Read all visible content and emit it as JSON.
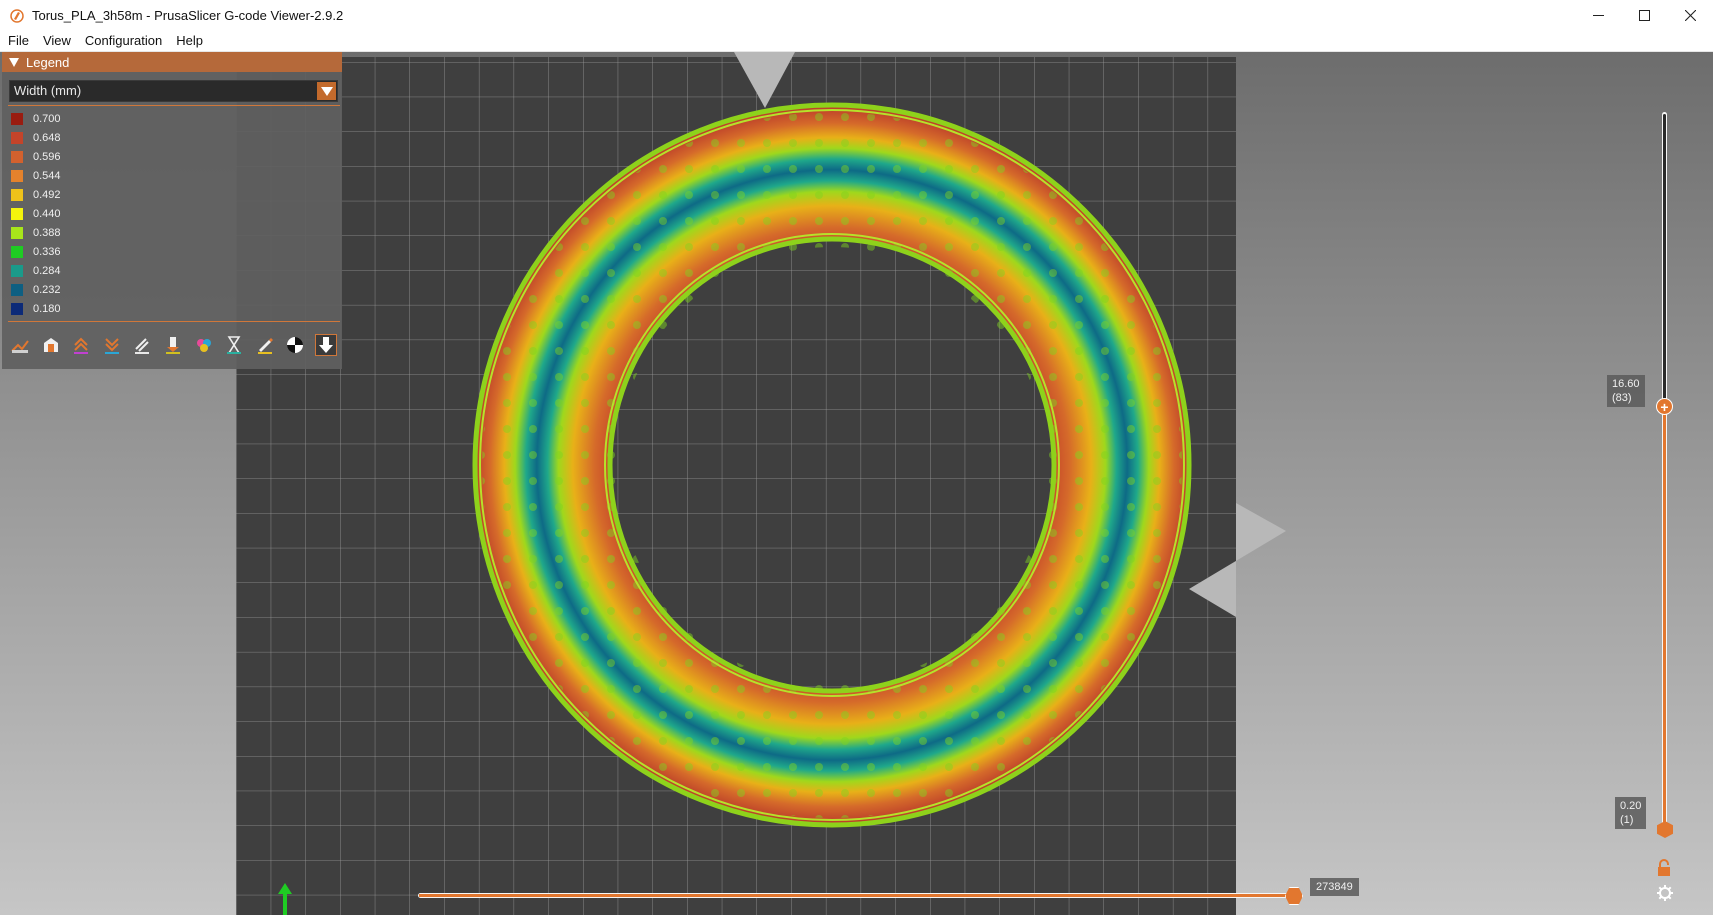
{
  "window": {
    "title": "Torus_PLA_3h58m - PrusaSlicer G-code Viewer-2.9.2"
  },
  "menu": [
    "File",
    "View",
    "Configuration",
    "Help"
  ],
  "legend": {
    "header": "Legend",
    "view_type": "Width (mm)",
    "items": [
      {
        "value": "0.700",
        "color": "#9a1c10"
      },
      {
        "value": "0.648",
        "color": "#c4442a"
      },
      {
        "value": "0.596",
        "color": "#d2612e"
      },
      {
        "value": "0.544",
        "color": "#e4822c"
      },
      {
        "value": "0.492",
        "color": "#eec21a"
      },
      {
        "value": "0.440",
        "color": "#f4f40c"
      },
      {
        "value": "0.388",
        "color": "#a8e61a"
      },
      {
        "value": "0.336",
        "color": "#1fcc23"
      },
      {
        "value": "0.284",
        "color": "#1a9a8a"
      },
      {
        "value": "0.232",
        "color": "#0e5f82"
      },
      {
        "value": "0.180",
        "color": "#0c2a78"
      }
    ],
    "toolbar_icons": [
      "travel-icon",
      "wipe-icon",
      "retractions-icon",
      "deretractions-icon",
      "seams-icon",
      "tool-changes-icon",
      "color-changes-icon",
      "pause-prints-icon",
      "custom-gcodes-icon",
      "center-of-gravity-icon",
      "tool-marker-icon"
    ]
  },
  "vertical_slider": {
    "top_label": "16.60\n(83)",
    "top_height": "16.60",
    "top_layer": "(83)",
    "bottom_height": "0.20",
    "bottom_layer": "(1)"
  },
  "horizontal_slider": {
    "value": "273849"
  },
  "colors": {
    "accent": "#e2772f",
    "legend_header": "#b5693a",
    "bed": "#3f3f3f",
    "grid": "#9a9a9a"
  }
}
